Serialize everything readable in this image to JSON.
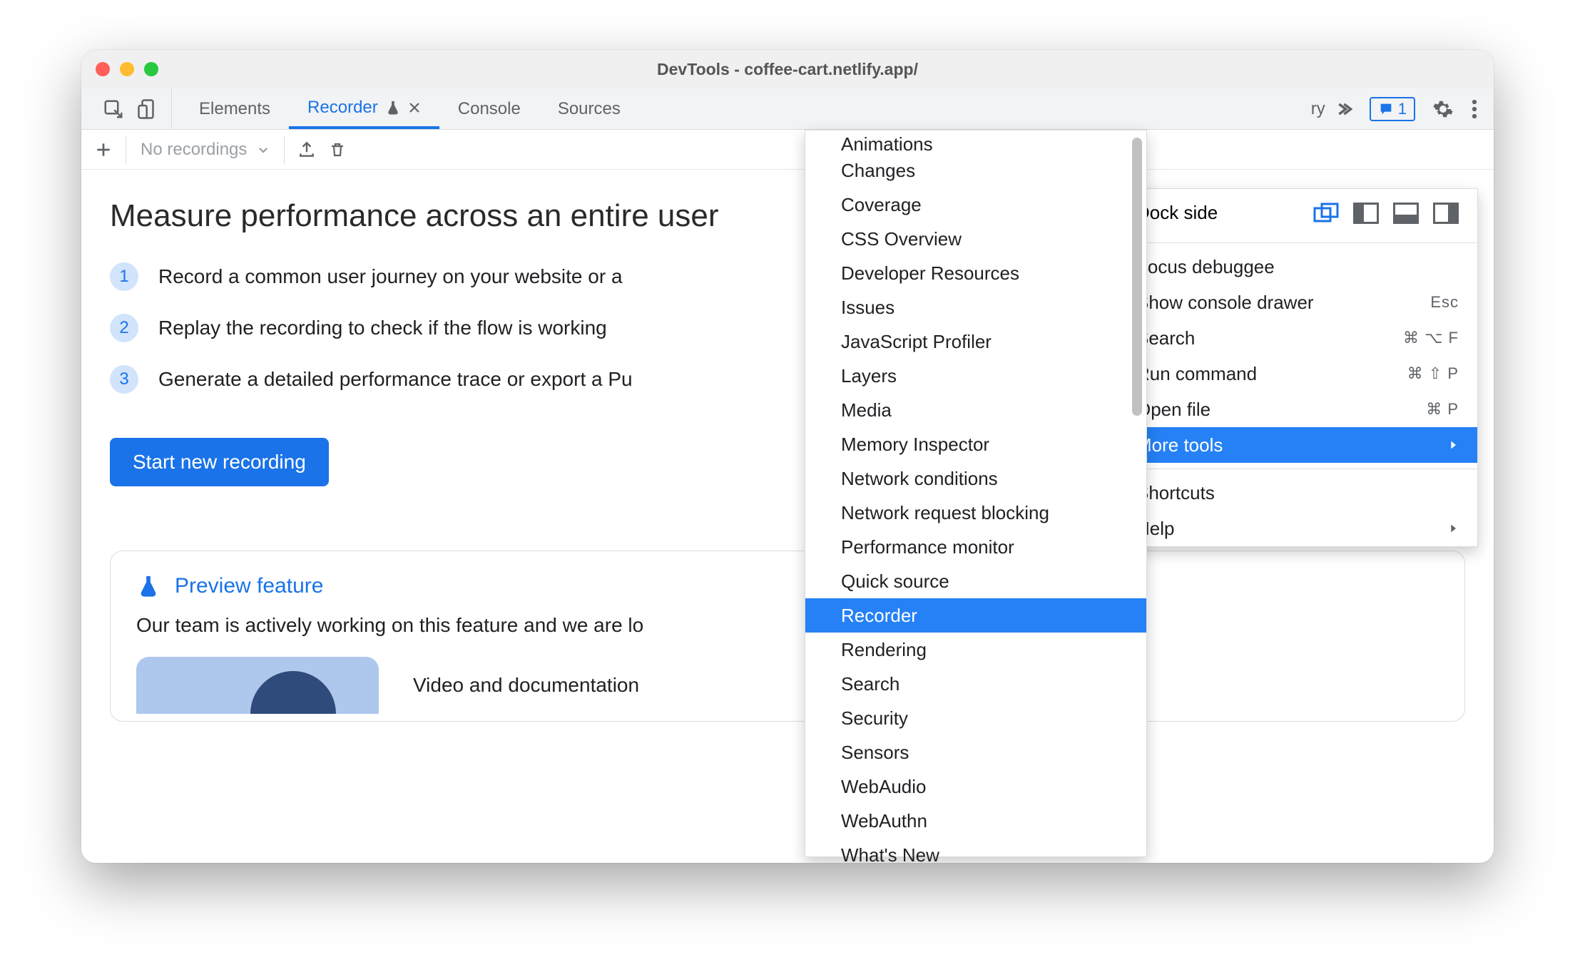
{
  "window": {
    "title": "DevTools - coffee-cart.netlify.app/"
  },
  "tabs": {
    "items": [
      "Elements",
      "Recorder",
      "Console",
      "Sources"
    ],
    "active_index": 1,
    "overflow_hint": "ry",
    "issues_count": "1"
  },
  "toolbar": {
    "recordings_label": "No recordings"
  },
  "main": {
    "heading": "Measure performance across an entire user",
    "steps": [
      "Record a common user journey on your website or a",
      "Replay the recording to check if the flow is working",
      "Generate a detailed performance trace or export a Pu"
    ],
    "primary_button": "Start new recording",
    "preview": {
      "title": "Preview feature",
      "body": "Our team is actively working on this feature and we are lo",
      "doc_title": "Video and documentation"
    }
  },
  "context_menu": {
    "dock_label": "Dock side",
    "rows": [
      {
        "label": "Focus debuggee",
        "shortcut": ""
      },
      {
        "label": "Show console drawer",
        "shortcut": "Esc"
      },
      {
        "label": "Search",
        "shortcut": "⌘ ⌥ F"
      },
      {
        "label": "Run command",
        "shortcut": "⌘ ⇧ P"
      },
      {
        "label": "Open file",
        "shortcut": "⌘ P"
      },
      {
        "label": "More tools",
        "shortcut": "",
        "submenu": true,
        "highlight": true
      }
    ],
    "rows2": [
      {
        "label": "Shortcuts",
        "shortcut": ""
      },
      {
        "label": "Help",
        "shortcut": "",
        "submenu": true
      }
    ]
  },
  "submenu": {
    "items": [
      "Animations",
      "Changes",
      "Coverage",
      "CSS Overview",
      "Developer Resources",
      "Issues",
      "JavaScript Profiler",
      "Layers",
      "Media",
      "Memory Inspector",
      "Network conditions",
      "Network request blocking",
      "Performance monitor",
      "Quick source",
      "Recorder",
      "Rendering",
      "Search",
      "Security",
      "Sensors",
      "WebAudio",
      "WebAuthn",
      "What's New"
    ],
    "highlight_index": 14
  }
}
